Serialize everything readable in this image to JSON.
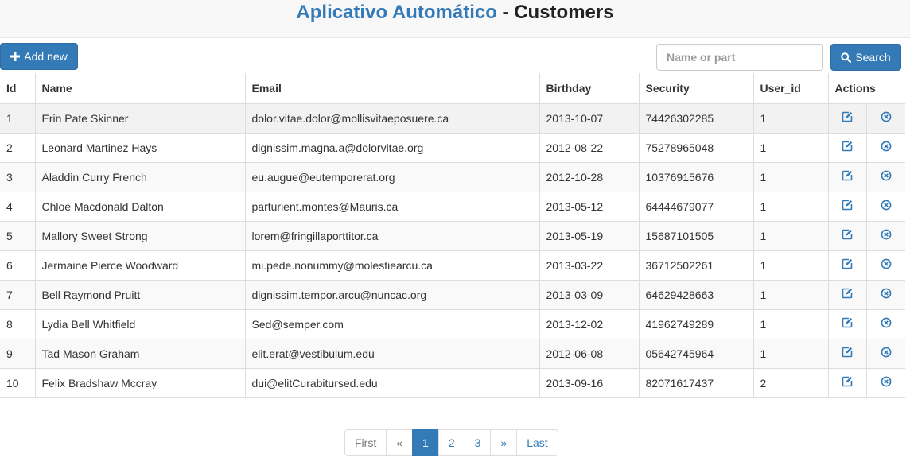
{
  "header": {
    "app_name": "Aplicativo Automático",
    "separator": " - ",
    "page_title": "Customers"
  },
  "toolbar": {
    "add_label": "Add new",
    "search_placeholder": "Name or part",
    "search_value": "",
    "search_label": "Search"
  },
  "table": {
    "columns": [
      "Id",
      "Name",
      "Email",
      "Birthday",
      "Security",
      "User_id",
      "Actions"
    ],
    "rows": [
      [
        "1",
        "Erin Pate Skinner",
        "dolor.vitae.dolor@mollisvitaeposuere.ca",
        "2013-10-07",
        "74426302285",
        "1"
      ],
      [
        "2",
        "Leonard Martinez Hays",
        "dignissim.magna.a@dolorvitae.org",
        "2012-08-22",
        "75278965048",
        "1"
      ],
      [
        "3",
        "Aladdin Curry French",
        "eu.augue@eutemporerat.org",
        "2012-10-28",
        "10376915676",
        "1"
      ],
      [
        "4",
        "Chloe Macdonald Dalton",
        "parturient.montes@Mauris.ca",
        "2013-05-12",
        "64444679077",
        "1"
      ],
      [
        "5",
        "Mallory Sweet Strong",
        "lorem@fringillaporttitor.ca",
        "2013-05-19",
        "15687101505",
        "1"
      ],
      [
        "6",
        "Jermaine Pierce Woodward",
        "mi.pede.nonummy@molestiearcu.ca",
        "2013-03-22",
        "36712502261",
        "1"
      ],
      [
        "7",
        "Bell Raymond Pruitt",
        "dignissim.tempor.arcu@nuncac.org",
        "2013-03-09",
        "64629428663",
        "1"
      ],
      [
        "8",
        "Lydia Bell Whitfield",
        "Sed@semper.com",
        "2013-12-02",
        "41962749289",
        "1"
      ],
      [
        "9",
        "Tad Mason Graham",
        "elit.erat@vestibulum.edu",
        "2012-06-08",
        "05642745964",
        "1"
      ],
      [
        "10",
        "Felix Bradshaw Mccray",
        "dui@elitCurabitursed.edu",
        "2013-09-16",
        "82071617437",
        "2"
      ]
    ]
  },
  "pagination": [
    {
      "label": "First",
      "state": "disabled"
    },
    {
      "label": "«",
      "state": "disabled"
    },
    {
      "label": "1",
      "state": "active"
    },
    {
      "label": "2",
      "state": "normal"
    },
    {
      "label": "3",
      "state": "normal"
    },
    {
      "label": "»",
      "state": "normal"
    },
    {
      "label": "Last",
      "state": "normal"
    }
  ],
  "icons": {
    "add": "plus-icon",
    "search": "search-icon",
    "edit": "edit-icon",
    "delete": "delete-circle-icon"
  },
  "colors": {
    "primary": "#337ab7",
    "header_bg": "#f8f8f8"
  }
}
